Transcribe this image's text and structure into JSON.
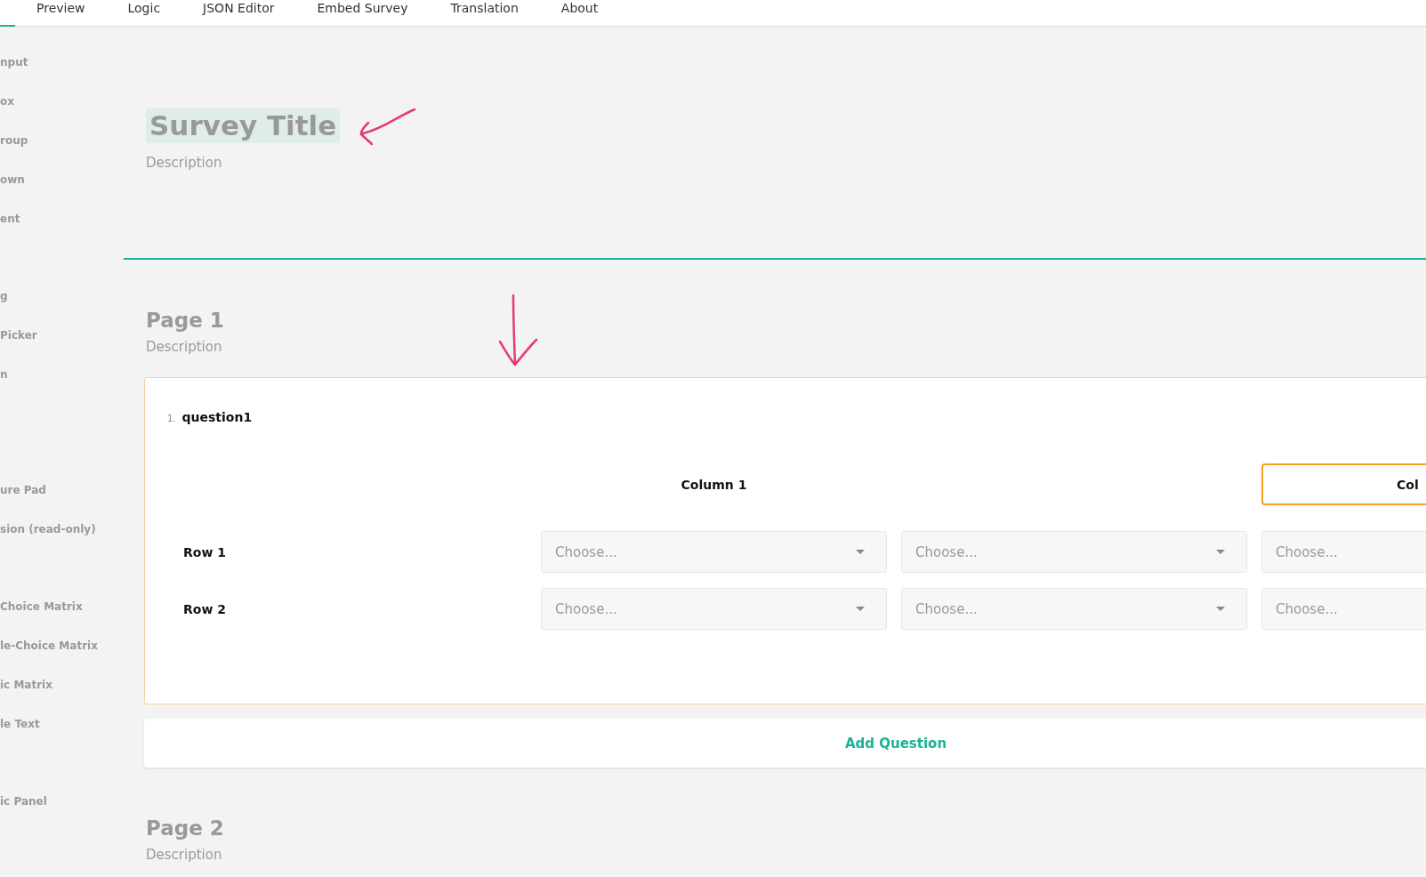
{
  "tabs": [
    {
      "label": "Preview",
      "selected": false
    },
    {
      "label": "Logic",
      "selected": false
    },
    {
      "label": "JSON Editor",
      "selected": false
    },
    {
      "label": "Embed Survey",
      "selected": false
    },
    {
      "label": "Translation",
      "selected": false
    },
    {
      "label": "About",
      "selected": false
    }
  ],
  "toolbox": {
    "items": [
      "nput",
      "ox",
      "roup",
      "own",
      "ent",
      "g",
      "Picker",
      "n",
      "ure Pad",
      "sion (read-only)",
      "Choice Matrix",
      "le-Choice Matrix",
      "ic Matrix",
      "le Text",
      "ic Panel"
    ]
  },
  "survey": {
    "title": "Survey Title",
    "description": "Description"
  },
  "pages": [
    {
      "title": "Page 1",
      "description": "Description",
      "questions": [
        {
          "number": "1.",
          "title": "question1",
          "columns": [
            {
              "header": "Column 1",
              "selected": false
            },
            {
              "selected": false
            },
            {
              "header": "Col",
              "selected": true
            }
          ],
          "rows": [
            {
              "label": "Row 1",
              "cells": [
                {
                  "placeholder": "Choose..."
                },
                {
                  "placeholder": "Choose..."
                },
                {
                  "placeholder": "Choose..."
                }
              ]
            },
            {
              "label": "Row 2",
              "cells": [
                {
                  "placeholder": "Choose..."
                },
                {
                  "placeholder": "Choose..."
                },
                {
                  "placeholder": "Choose..."
                }
              ]
            }
          ]
        }
      ],
      "add_question": "Add Question"
    },
    {
      "title": "Page 2",
      "description": "Description"
    }
  ]
}
